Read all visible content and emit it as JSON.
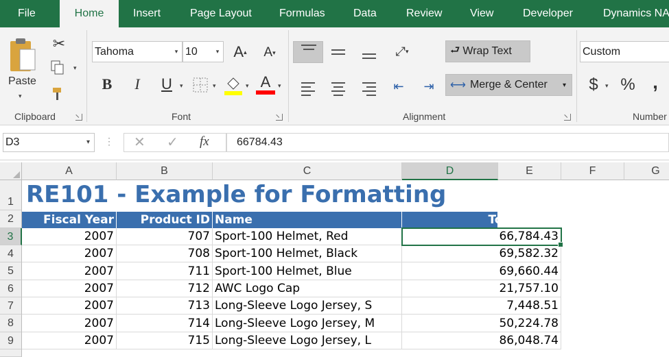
{
  "ribbon_tabs": [
    "File",
    "Home",
    "Insert",
    "Page Layout",
    "Formulas",
    "Data",
    "Review",
    "View",
    "Developer",
    "Dynamics NA"
  ],
  "active_tab": "Home",
  "clipboard": {
    "paste_label": "Paste",
    "group_label": "Clipboard"
  },
  "font": {
    "name": "Tahoma",
    "size": "10",
    "group_label": "Font",
    "bold": "B",
    "italic": "I",
    "underline": "U",
    "grow": "A",
    "shrink": "A",
    "color_letter": "A"
  },
  "alignment": {
    "wrap_text": "Wrap Text",
    "merge_center": "Merge & Center",
    "group_label": "Alignment"
  },
  "number": {
    "format": "Custom",
    "currency": "$",
    "percent": "%",
    "comma": ",",
    "group_label": "Number"
  },
  "formula_bar": {
    "name_box": "D3",
    "fx": "fx",
    "value": "66784.43"
  },
  "columns": [
    "A",
    "B",
    "C",
    "D",
    "E",
    "F",
    "G"
  ],
  "rows": [
    "1",
    "2",
    "3",
    "4",
    "5",
    "6",
    "7",
    "8",
    "9"
  ],
  "sheet": {
    "title": "RE101 - Example for Formatting",
    "headers": {
      "fiscal_year": "Fiscal Year",
      "product_id": "Product ID",
      "name": "Name",
      "total_sales": "Total Sales"
    },
    "data": [
      {
        "year": "2007",
        "id": "707",
        "name": "Sport-100 Helmet, Red",
        "sales": "66,784.43"
      },
      {
        "year": "2007",
        "id": "708",
        "name": "Sport-100 Helmet, Black",
        "sales": "69,582.32"
      },
      {
        "year": "2007",
        "id": "711",
        "name": "Sport-100 Helmet, Blue",
        "sales": "69,660.44"
      },
      {
        "year": "2007",
        "id": "712",
        "name": "AWC Logo Cap",
        "sales": "21,757.10"
      },
      {
        "year": "2007",
        "id": "713",
        "name": "Long-Sleeve Logo Jersey, S",
        "sales": "7,448.51"
      },
      {
        "year": "2007",
        "id": "714",
        "name": "Long-Sleeve Logo Jersey, M",
        "sales": "50,224.78"
      },
      {
        "year": "2007",
        "id": "715",
        "name": "Long-Sleeve Logo Jersey, L",
        "sales": "86,048.74"
      }
    ]
  },
  "colors": {
    "excel_green": "#217346",
    "header_blue": "#3a6fae",
    "highlight_yellow": "#ffff00",
    "font_red": "#ff0000"
  }
}
